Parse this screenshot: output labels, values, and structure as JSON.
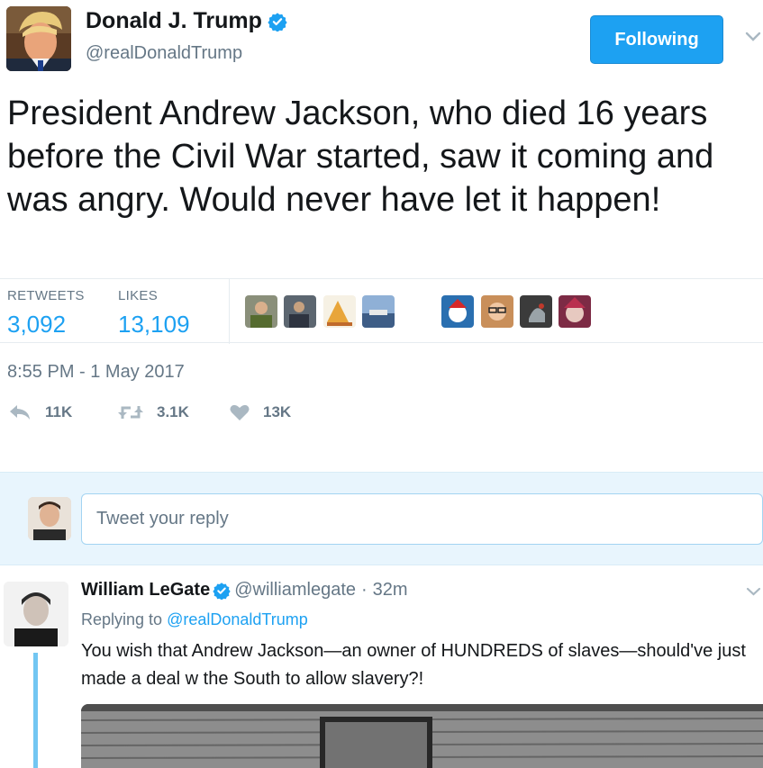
{
  "tweet": {
    "author_name": "Donald J. Trump",
    "author_handle": "@realDonaldTrump",
    "follow_label": "Following",
    "text": "President Andrew Jackson, who died 16 years before the Civil War started, saw it coming and was angry. Would never have let it happen!",
    "stats": {
      "retweets_label": "RETWEETS",
      "retweets_value": "3,092",
      "likes_label": "LIKES",
      "likes_value": "13,109"
    },
    "timestamp": "8:55 PM - 1 May 2017",
    "actions": {
      "reply_count": "11K",
      "retweet_count": "3.1K",
      "like_count": "13K"
    }
  },
  "reply_box": {
    "placeholder": "Tweet your reply"
  },
  "reply_tweet": {
    "author_name": "William LeGate",
    "author_handle": "@williamlegate",
    "separator": "·",
    "time": "32m",
    "replying_prefix": "Replying to",
    "replying_to": "@realDonaldTrump",
    "text": "You wish that Andrew Jackson—an owner of HUNDREDS of slaves—should've just made a deal w the South to allow slavery?!"
  },
  "colors": {
    "accent": "#1da1f2",
    "text_secondary": "#657786",
    "reply_bg": "#e8f5fd",
    "thread_line": "#72c6f2"
  },
  "icons": {
    "verified": "verified-badge-icon",
    "caret": "chevron-down-icon",
    "reply": "reply-icon",
    "retweet": "retweet-icon",
    "like": "heart-icon"
  }
}
